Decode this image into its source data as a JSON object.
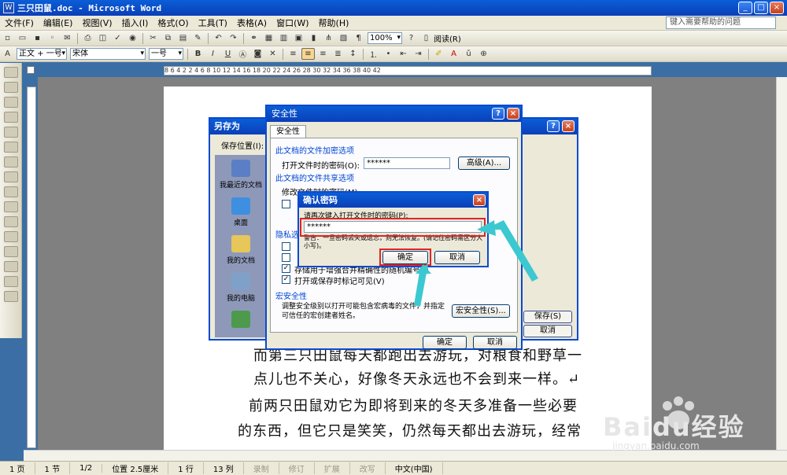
{
  "window": {
    "title": "三只田鼠.doc - Microsoft Word",
    "min": "_",
    "max": "□",
    "close": "×"
  },
  "menu": {
    "items": [
      "文件(F)",
      "编辑(E)",
      "视图(V)",
      "插入(I)",
      "格式(O)",
      "工具(T)",
      "表格(A)",
      "窗口(W)",
      "帮助(H)"
    ],
    "help_placeholder": "键入需要帮助的问题"
  },
  "toolbar1": {
    "zoom": "100%",
    "reading": "阅读(R)"
  },
  "toolbar2": {
    "style": "正文 + 一号",
    "font": "宋体",
    "size": "一号",
    "bold": "B",
    "italic": "I",
    "underline": "U"
  },
  "ruler": {
    "marks": "8  6  4  2     2  4  6  8  10  12  14  16  18  20  22  24  26  28  30  32  34  36  38  40  42"
  },
  "document": {
    "lines": [
      "而第三只田鼠每天都跑出去游玩，对粮食和野草一",
      "点儿也不关心，好像冬天永远也不会到来一样。↵",
      "前两只田鼠劝它为即将到来的冬天多准备一些必要",
      "的东西，但它只是笑笑，仍然每天都出去游玩，经常"
    ]
  },
  "saveas": {
    "title": "另存为",
    "location_label": "保存位置(I):",
    "places": [
      "我最近的文档",
      "桌面",
      "我的文档",
      "我的电脑"
    ],
    "save": "保存(S)",
    "cancel": "取消"
  },
  "security": {
    "title": "安全性",
    "tab": "安全性",
    "encrypt_section": "此文档的文件加密选项",
    "open_pw_label": "打开文件时的密码(O):",
    "open_pw_value": "******",
    "advanced": "高级(A)...",
    "share_section": "此文档的文件共享选项",
    "modify_pw_label": "修改文件时的密码(M):",
    "privacy_section": "隐私选项",
    "opt_merge": "存储用于增强合并精确性的随机编号(I)",
    "opt_track": "打开或保存时标记可见(V)",
    "macro_section": "宏安全性",
    "macro_desc": "调整安全级别以打开可能包含宏病毒的文件，并指定可信任的宏创建者姓名。",
    "macro_button": "宏安全性(S)...",
    "ok": "确定",
    "cancel": "取消"
  },
  "confirm": {
    "title": "确认密码",
    "prompt": "请再次键入打开文件时的密码(P):",
    "value": "******",
    "warning": "警告：一旦密码丢失或遗忘，则无法恢复。(请记住密码需区分大小写)。",
    "ok": "确定",
    "cancel": "取消"
  },
  "status": {
    "page": "1 页",
    "section": "1 节",
    "pages": "1/2",
    "position": "位置 2.5厘米",
    "line": "1 行",
    "col": "13 列",
    "rec": "录制",
    "trk": "修订",
    "ext": "扩展",
    "ovr": "改写",
    "lang": "中文(中国)"
  },
  "watermark": {
    "brand": "Baidu经验",
    "url": "jingyan.baidu.com"
  },
  "colors": {
    "title_blue": "#0a4ad0",
    "highlight_red": "#e02424",
    "arrow_cyan": "#3cc8d0"
  }
}
